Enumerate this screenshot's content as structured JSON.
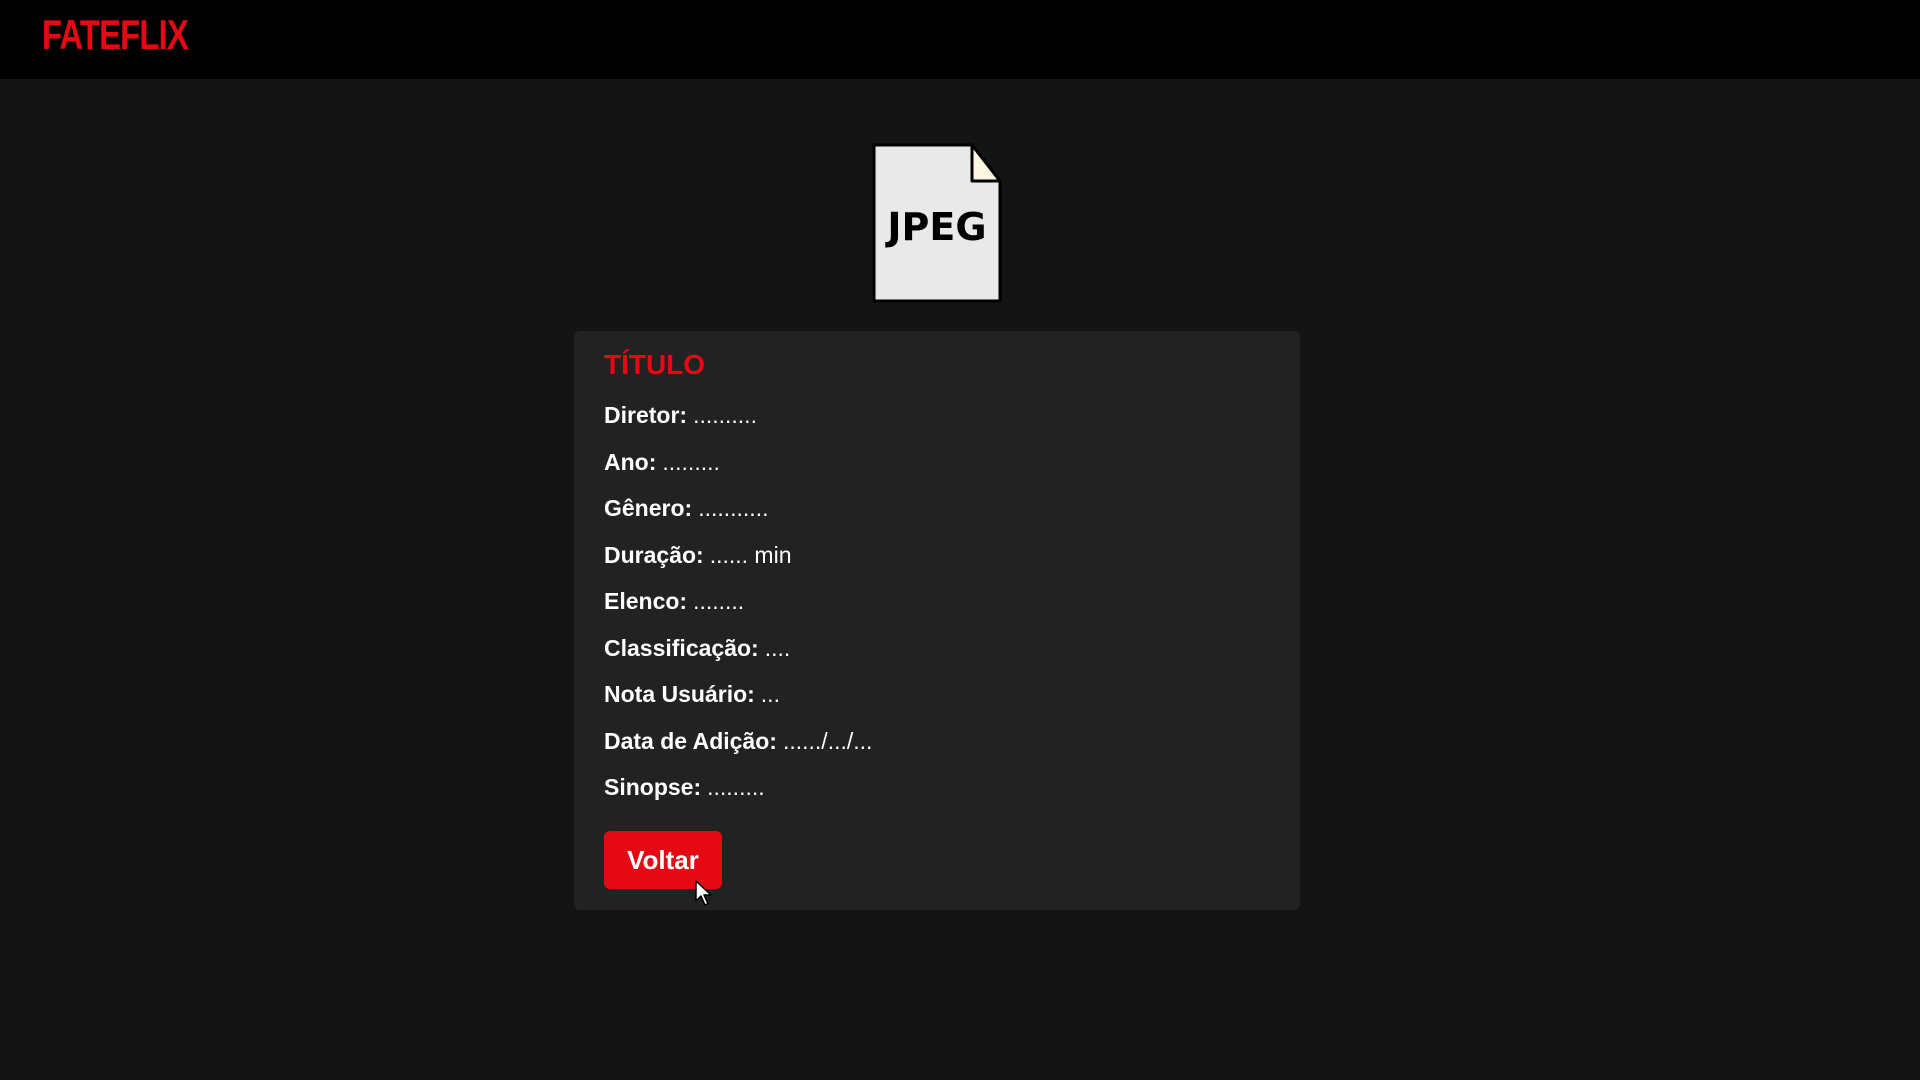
{
  "header": {
    "logo_text": "FATEFLIX",
    "logo_color": "#e50914",
    "background": "#000000"
  },
  "poster": {
    "icon": "jpeg-file-icon",
    "label": "JPEG"
  },
  "movie": {
    "title": "TÍTULO",
    "fields": [
      {
        "label": "Diretor:",
        "value": ".........."
      },
      {
        "label": "Ano:",
        "value": "........."
      },
      {
        "label": "Gênero:",
        "value": "..........."
      },
      {
        "label": "Duração:",
        "value": "...... min"
      },
      {
        "label": "Elenco:",
        "value": "........"
      },
      {
        "label": "Classificação:",
        "value": "...."
      },
      {
        "label": "Nota Usuário:",
        "value": "..."
      },
      {
        "label": "Data de Adição:",
        "value": "....../.../..."
      },
      {
        "label": "Sinopse:",
        "value": "........."
      }
    ]
  },
  "actions": {
    "back_label": "Voltar"
  },
  "colors": {
    "accent": "#e50914",
    "page_background": "#141414",
    "card_background": "#222222",
    "text": "#ffffff"
  }
}
